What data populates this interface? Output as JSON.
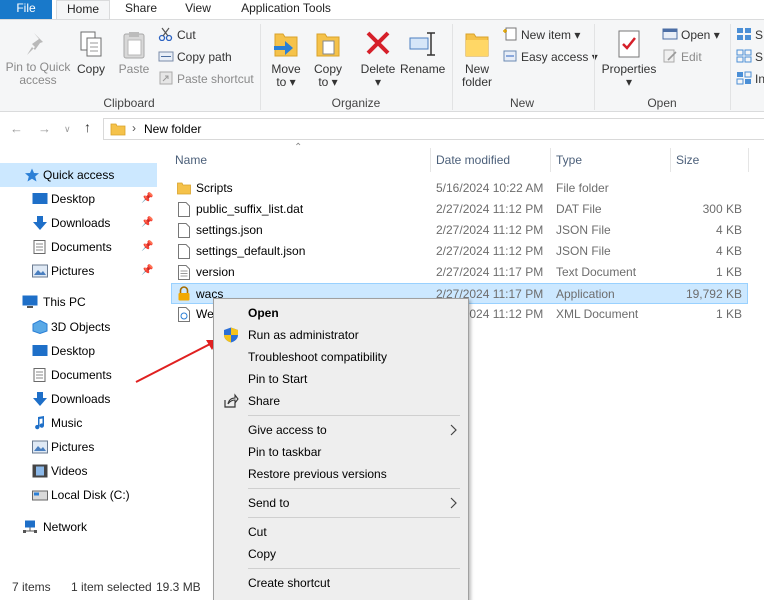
{
  "ribbon": {
    "tabs": [
      "File",
      "Home",
      "Share",
      "View",
      "Application Tools"
    ],
    "clipboard": {
      "label": "Clipboard",
      "pin_quick_access": [
        "Pin to Quick",
        "access"
      ],
      "copy": "Copy",
      "paste": "Paste",
      "cut": "Cut",
      "copy_path": "Copy path",
      "paste_shortcut": "Paste shortcut"
    },
    "organize": {
      "label": "Organize",
      "move_to": [
        "Move",
        "to"
      ],
      "copy_to": [
        "Copy",
        "to"
      ],
      "delete": "Delete",
      "rename": "Rename"
    },
    "new": {
      "label": "New",
      "new_folder": [
        "New",
        "folder"
      ],
      "new_item": "New item",
      "easy_access": "Easy access"
    },
    "open": {
      "label": "Open",
      "properties": "Properties",
      "open": "Open",
      "edit": "Edit"
    },
    "select": {
      "items": [
        "S",
        "S",
        "In"
      ]
    }
  },
  "address": {
    "path": "New folder"
  },
  "nav": {
    "quick_access": "Quick access",
    "quick_items": [
      "Desktop",
      "Downloads",
      "Documents",
      "Pictures"
    ],
    "this_pc": "This PC",
    "pc_items": [
      "3D Objects",
      "Desktop",
      "Documents",
      "Downloads",
      "Music",
      "Pictures",
      "Videos",
      "Local Disk (C:)"
    ],
    "network": "Network"
  },
  "columns": {
    "name": "Name",
    "date": "Date modified",
    "type": "Type",
    "size": "Size"
  },
  "files": [
    {
      "name": "Scripts",
      "date": "5/16/2024 10:22 AM",
      "type": "File folder",
      "size": "",
      "icon": "folder-icon"
    },
    {
      "name": "public_suffix_list.dat",
      "date": "2/27/2024 11:12 PM",
      "type": "DAT File",
      "size": "300 KB",
      "icon": "file-icon"
    },
    {
      "name": "settings.json",
      "date": "2/27/2024 11:12 PM",
      "type": "JSON File",
      "size": "4 KB",
      "icon": "file-icon"
    },
    {
      "name": "settings_default.json",
      "date": "2/27/2024 11:12 PM",
      "type": "JSON File",
      "size": "4 KB",
      "icon": "file-icon"
    },
    {
      "name": "version",
      "date": "2/27/2024 11:17 PM",
      "type": "Text Document",
      "size": "1 KB",
      "icon": "text-file-icon"
    },
    {
      "name": "wacs",
      "date": "2/27/2024 11:17 PM",
      "type": "Application",
      "size": "19,792 KB",
      "icon": "lock-icon"
    },
    {
      "name": "We",
      "date": "2/27/2024 11:12 PM",
      "type": "XML Document",
      "size": "1 KB",
      "icon": "xml-file-icon"
    }
  ],
  "status": {
    "items": "7 items",
    "selected": "1 item selected",
    "size": "19.3 MB"
  },
  "context_menu": {
    "open": "Open",
    "run_as_admin": "Run as administrator",
    "troubleshoot": "Troubleshoot compatibility",
    "pin_start": "Pin to Start",
    "share": "Share",
    "give_access": "Give access to",
    "pin_taskbar": "Pin to taskbar",
    "restore": "Restore previous versions",
    "send_to": "Send to",
    "cut": "Cut",
    "copy": "Copy",
    "create_shortcut": "Create shortcut"
  },
  "colors": {
    "file_tab": "#1979ca",
    "selection": "#cce8ff",
    "annotation_arrow": "#e02020"
  }
}
